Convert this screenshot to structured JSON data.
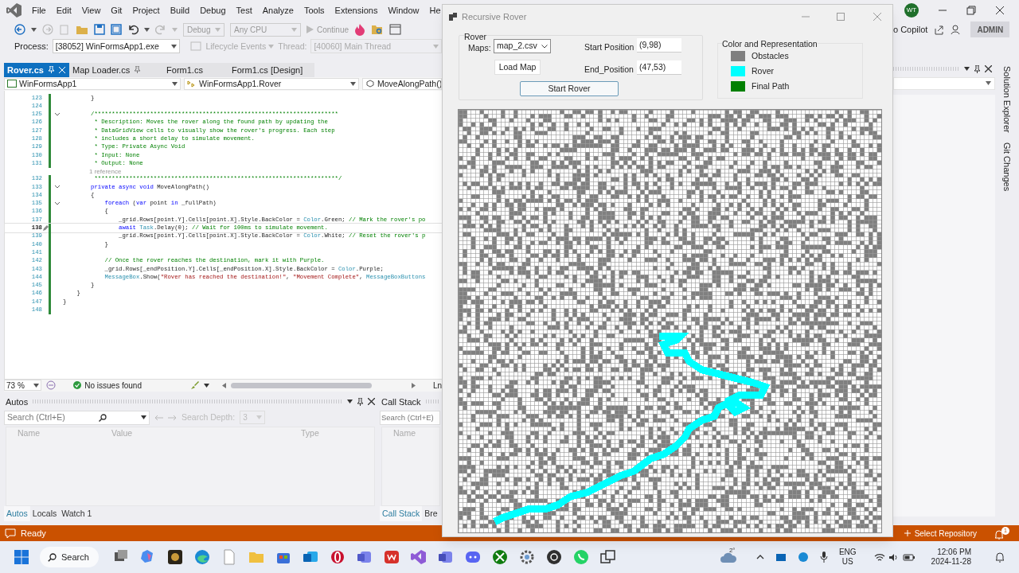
{
  "ide": {
    "menu": [
      "File",
      "Edit",
      "View",
      "Git",
      "Project",
      "Build",
      "Debug",
      "Test",
      "Analyze",
      "Tools",
      "Extensions",
      "Window",
      "He"
    ],
    "account_initials": "WT",
    "toolbar": {
      "configuration": "Debug",
      "platform": "Any CPU",
      "continue": "Continue",
      "copilot": "o Copilot",
      "admin": "ADMIN"
    },
    "debug_bar": {
      "process_label": "Process:",
      "process": "[38052] WinFormsApp1.exe",
      "lifecycle": "Lifecycle Events",
      "thread_label": "Thread:",
      "thread": "[40060] Main Thread"
    },
    "tabs": [
      {
        "label": "Rover.cs",
        "selected": true,
        "pinned": true
      },
      {
        "label": "Map Loader.cs",
        "selected": false,
        "pinned": true
      },
      {
        "label": "Form1.cs",
        "selected": false,
        "pinned": false
      },
      {
        "label": "Form1.cs [Design]",
        "selected": false,
        "pinned": false
      }
    ],
    "nav": [
      "WinFormsApp1",
      "WinFormsApp1.Rover",
      "MoveAlongPath()"
    ],
    "code": [
      {
        "number": "123",
        "current": false,
        "segments": [
          {
            "kind": "plain",
            "text": "        }"
          }
        ]
      },
      {
        "number": "124",
        "current": false
      },
      {
        "number": "125",
        "current": false,
        "fold": true,
        "segments": [
          {
            "kind": "comment",
            "text": "        /**********************************************************************"
          }
        ]
      },
      {
        "number": "126",
        "current": false,
        "segments": [
          {
            "kind": "comment",
            "text": "         * Description: Moves the rover along the found path by updating the"
          }
        ]
      },
      {
        "number": "127",
        "current": false,
        "segments": [
          {
            "kind": "comment",
            "text": "         * DataGridView cells to visually show the rover's progress. Each step"
          }
        ]
      },
      {
        "number": "128",
        "current": false,
        "segments": [
          {
            "kind": "comment",
            "text": "         * includes a short delay to simulate movement."
          }
        ]
      },
      {
        "number": "129",
        "current": false,
        "segments": [
          {
            "kind": "comment",
            "text": "         * Type: Private Async Void"
          }
        ]
      },
      {
        "number": "130",
        "current": false,
        "segments": [
          {
            "kind": "comment",
            "text": "         * Input: None"
          }
        ]
      },
      {
        "number": "131",
        "current": false,
        "segments": [
          {
            "kind": "comment",
            "text": "         * Output: None"
          }
        ]
      },
      {
        "number": "132",
        "current": false,
        "segments": [
          {
            "kind": "comment",
            "text": "         **********************************************************************/"
          }
        ],
        "lens": "1 reference"
      },
      {
        "number": "133",
        "current": false,
        "fold": true,
        "segments": [
          {
            "kind": "keyword",
            "text": "        private async void"
          },
          {
            "kind": "plain",
            "text": " MoveAlongPath()"
          }
        ]
      },
      {
        "number": "134",
        "current": false,
        "segments": [
          {
            "kind": "plain",
            "text": "        {"
          }
        ]
      },
      {
        "number": "135",
        "current": false,
        "fold": true,
        "segments": [
          {
            "kind": "keyword",
            "text": "            foreach"
          },
          {
            "kind": "plain",
            "text": " ("
          },
          {
            "kind": "keyword",
            "text": "var"
          },
          {
            "kind": "plain",
            "text": " point "
          },
          {
            "kind": "keyword",
            "text": "in"
          },
          {
            "kind": "plain",
            "text": " _fullPath)"
          }
        ]
      },
      {
        "number": "136",
        "current": false,
        "segments": [
          {
            "kind": "plain",
            "text": "            {"
          }
        ]
      },
      {
        "number": "137",
        "current": false,
        "segments": [
          {
            "kind": "plain",
            "text": "                _grid.Rows[point.Y].Cells[point.X].Style.BackColor = "
          },
          {
            "kind": "type",
            "text": "Color"
          },
          {
            "kind": "plain",
            "text": ".Green; "
          },
          {
            "kind": "comment",
            "text": "// Mark the rover's po"
          }
        ]
      },
      {
        "number": "138",
        "current": true,
        "segments": [
          {
            "kind": "keyword",
            "text": "                await"
          },
          {
            "kind": "type",
            "text": " Task"
          },
          {
            "kind": "plain",
            "text": ".Delay(0); "
          },
          {
            "kind": "comment",
            "text": "// Wait for 100ms to simulate movement."
          }
        ]
      },
      {
        "number": "139",
        "current": false,
        "segments": [
          {
            "kind": "plain",
            "text": "                _grid.Rows[point.Y].Cells[point.X].Style.BackColor = "
          },
          {
            "kind": "type",
            "text": "Color"
          },
          {
            "kind": "plain",
            "text": ".White; "
          },
          {
            "kind": "comment",
            "text": "// Reset the rover's p"
          }
        ]
      },
      {
        "number": "140",
        "current": false,
        "segments": [
          {
            "kind": "plain",
            "text": "            }"
          }
        ]
      },
      {
        "number": "141",
        "current": false
      },
      {
        "number": "142",
        "current": false,
        "segments": [
          {
            "kind": "comment",
            "text": "            // Once the rover reaches the destination, mark it with Purple."
          }
        ]
      },
      {
        "number": "143",
        "current": false,
        "segments": [
          {
            "kind": "plain",
            "text": "            _grid.Rows[_endPosition.Y].Cells[_endPosition.X].Style.BackColor = "
          },
          {
            "kind": "type",
            "text": "Color"
          },
          {
            "kind": "plain",
            "text": ".Purple;"
          }
        ]
      },
      {
        "number": "144",
        "current": false,
        "segments": [
          {
            "kind": "type",
            "text": "            MessageBox"
          },
          {
            "kind": "plain",
            "text": ".Show("
          },
          {
            "kind": "string",
            "text": "\"Rover has reached the destination!\""
          },
          {
            "kind": "plain",
            "text": ", "
          },
          {
            "kind": "string",
            "text": "\"Movement Complete\""
          },
          {
            "kind": "plain",
            "text": ", "
          },
          {
            "kind": "type",
            "text": "MessageBoxButtons"
          }
        ]
      },
      {
        "number": "145",
        "current": false,
        "segments": [
          {
            "kind": "plain",
            "text": "        }"
          }
        ]
      },
      {
        "number": "146",
        "current": false,
        "segments": [
          {
            "kind": "plain",
            "text": "    }"
          }
        ]
      },
      {
        "number": "147",
        "current": false,
        "segments": [
          {
            "kind": "plain",
            "text": "}"
          }
        ]
      },
      {
        "number": "148",
        "current": false
      }
    ],
    "editor_status": {
      "zoom": "73 %",
      "issues": "No issues found",
      "position": "Ln"
    },
    "autos": {
      "title": "Autos",
      "search_placeholder": "Search (Ctrl+E)",
      "depth_label": "Search Depth:",
      "depth": "3",
      "columns": [
        "Name",
        "Value",
        "Type"
      ],
      "tabs": [
        {
          "label": "Autos",
          "selected": true
        },
        {
          "label": "Locals",
          "selected": false
        },
        {
          "label": "Watch 1",
          "selected": false
        }
      ]
    },
    "call_stack": {
      "title": "Call Stack",
      "search_placeholder": "Search (Ctrl+E)",
      "columns": [
        "Name"
      ],
      "tabs": [
        {
          "label": "Call Stack",
          "selected": true
        },
        {
          "label": "Bre",
          "selected": false
        }
      ]
    },
    "side_tabs": [
      "Solution Explorer",
      "Git Changes"
    ],
    "status_bar": {
      "text": "Ready",
      "repository": "Select Repository",
      "notifications": "1"
    }
  },
  "rover_window": {
    "title": "Recursive Rover",
    "group_label": "Rover",
    "maps_label": "Maps:",
    "map": "map_2.csv",
    "load_button": "Load Map",
    "start_label": "Start Position",
    "start_value": "(9,98)",
    "end_label": "End_Position",
    "end_value": "(47,53)",
    "start_button": "Start Rover",
    "legend_title": "Color and Representation",
    "legend": [
      {
        "label": "Obstacles",
        "color": "#808080"
      },
      {
        "label": "Rover",
        "color": "#00ffff"
      },
      {
        "label": "Final Path",
        "color": "#008000"
      }
    ]
  },
  "taskbar": {
    "search": "Search",
    "weather": "2°",
    "language": "ENG",
    "region": "US",
    "time": "12:06 PM",
    "date": "2024-11-28"
  }
}
